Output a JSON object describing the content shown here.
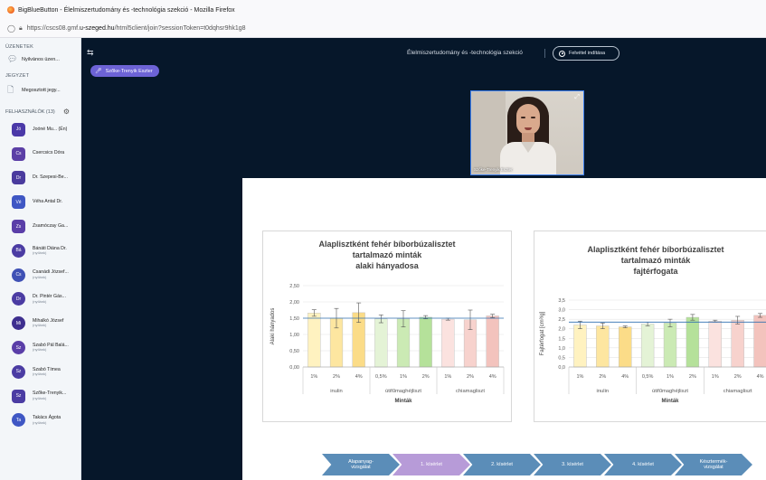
{
  "window": {
    "title": "BigBlueButton - Élelmiszertudomány és -technológia szekció - Mozilla Firefox",
    "url_prefix": "https://cscs08.gmf.",
    "url_domain": "u-szeged.hu",
    "url_suffix": "/html5client/join?sessionToken=t0dqhsr9hk1g8"
  },
  "sidebar": {
    "messages_title": "ÜZENETEK",
    "public_chat": "Nyilvános üzen...",
    "notes_title": "JEGYZET",
    "shared_notes": "Megosztott jegy...",
    "users_title": "FELHASZNÁLÓK (13)",
    "users": [
      {
        "initials": "Jó",
        "name": "Joóné Mu... (Én)",
        "sub": "",
        "color": "#4b39a8",
        "shape": "square",
        "badge": "green"
      },
      {
        "initials": "Cs",
        "name": "Csercsics Dóra",
        "sub": "",
        "color": "#5b3fa6",
        "shape": "square",
        "badge": ""
      },
      {
        "initials": "Dr",
        "name": "Dr. Szepesi-Be...",
        "sub": "",
        "color": "#4a3b9e",
        "shape": "square",
        "badge": "red"
      },
      {
        "initials": "Vé",
        "name": "Véha Antal Dr.",
        "sub": "",
        "color": "#3f57c4",
        "shape": "square",
        "badge": ""
      },
      {
        "initials": "Zs",
        "name": "Zsamóczay Ga...",
        "sub": "",
        "color": "#5a3ea8",
        "shape": "square",
        "badge": "red"
      },
      {
        "initials": "Bá",
        "name": "Bánáti Diána Dr.",
        "sub": "(nyílánk)",
        "color": "#4b3ca3",
        "shape": "round",
        "badge": "red"
      },
      {
        "initials": "Cs",
        "name": "Csanádi József...",
        "sub": "(nyílánk)",
        "color": "#3f51b5",
        "shape": "round",
        "badge": "green"
      },
      {
        "initials": "Dr",
        "name": "Dr. Pintér Gás...",
        "sub": "(nyílánk)",
        "color": "#4b3ca3",
        "shape": "round",
        "badge": "red"
      },
      {
        "initials": "Mi",
        "name": "Mihalkó József",
        "sub": "(nyílánk)",
        "color": "#3e2f8f",
        "shape": "round",
        "badge": "red"
      },
      {
        "initials": "Sz",
        "name": "Szabó Pál Balá...",
        "sub": "(nyílánk)",
        "color": "#5a3ea8",
        "shape": "round",
        "badge": "red"
      },
      {
        "initials": "Sz",
        "name": "Szabó Tímea",
        "sub": "(nyílánk)",
        "color": "#4b3ca3",
        "shape": "round",
        "badge": "green"
      },
      {
        "initials": "Sz",
        "name": "Szőke-Trenyik...",
        "sub": "(nyílánk)",
        "color": "#4b3ca3",
        "shape": "square",
        "badge": "green"
      },
      {
        "initials": "Ta",
        "name": "Takács Ágota",
        "sub": "(nyílánk)",
        "color": "#3f57c4",
        "shape": "round",
        "badge": "red"
      }
    ]
  },
  "main": {
    "session_title": "Élelmiszertudomány és -technológia szekció",
    "record_label": "Felvétel indítása",
    "presenter": "Szőke-Trenyik Eszter",
    "webcam_name": "Szőke-Trenyik Eszter"
  },
  "chart_data": [
    {
      "type": "bar",
      "title": "Alaplisztként fehér bíborbúzalisztet tartalmazó minták alaki hányadosa",
      "title_lines": [
        "Alaplisztként fehér bíborbúzalisztet",
        "tartalmazó minták",
        "alaki hányadosa"
      ],
      "ylabel": "Alaki hányados",
      "xlabel": "Minták",
      "ylim": [
        0,
        2.5
      ],
      "yticks": [
        "0,00",
        "0,50",
        "1,00",
        "1,50",
        "2,00",
        "2,50"
      ],
      "categories": [
        "1%",
        "2%",
        "4%",
        "0,5%",
        "1%",
        "2%",
        "1%",
        "2%",
        "4%"
      ],
      "groups": [
        {
          "label": "inulin",
          "count": 3
        },
        {
          "label": "útifűmaghéjliszt",
          "count": 3
        },
        {
          "label": "chiamagliszt",
          "count": 3
        }
      ],
      "values": [
        1.66,
        1.5,
        1.67,
        1.48,
        1.48,
        1.53,
        1.47,
        1.45,
        1.57
      ],
      "errors": [
        0.1,
        0.3,
        0.3,
        0.12,
        0.25,
        0.05,
        0.03,
        0.3,
        0.05
      ],
      "reference_line": 1.5,
      "colors": [
        "#fff2c0",
        "#fde6a0",
        "#fbdc88",
        "#e4f3d6",
        "#cbeab4",
        "#b5e19a",
        "#fbe2df",
        "#f7d2cd",
        "#f3c3bd"
      ]
    },
    {
      "type": "bar",
      "title": "Alaplisztként fehér bíborbúzalisztet tartalmazó minták fajtérfogata",
      "title_lines": [
        "Alaplisztként fehér bíborbúzalisztet",
        "tartalmazó minták",
        "fajtérfogata"
      ],
      "ylabel": "Fajtérfogat [cm³/g]",
      "xlabel": "Minták",
      "ylim": [
        0,
        3.5
      ],
      "yticks": [
        "0,0",
        "0,5",
        "1,0",
        "1,5",
        "2,0",
        "2,5",
        "3,0",
        "3,5"
      ],
      "categories": [
        "1%",
        "2%",
        "4%",
        "0,5%",
        "1%",
        "2%",
        "1%",
        "2%",
        "4%"
      ],
      "groups": [
        {
          "label": "inulin",
          "count": 3
        },
        {
          "label": "útifűmaghéjliszt",
          "count": 3
        },
        {
          "label": "chiamagliszt",
          "count": 3
        }
      ],
      "values": [
        2.2,
        2.15,
        2.1,
        2.25,
        2.3,
        2.6,
        2.4,
        2.45,
        2.7
      ],
      "errors": [
        0.2,
        0.15,
        0.05,
        0.1,
        0.2,
        0.15,
        0.05,
        0.2,
        0.1
      ],
      "reference_line": 2.35,
      "colors": [
        "#fff2c0",
        "#fde6a0",
        "#fbdc88",
        "#e4f3d6",
        "#cbeab4",
        "#b5e19a",
        "#fbe2df",
        "#f7d2cd",
        "#f3c3bd"
      ]
    }
  ],
  "flow": {
    "steps": [
      {
        "label": "Alapanyag-vizsgálat",
        "line1": "Alapanyag-",
        "line2": "vizsgálat",
        "color": "#5b8db8"
      },
      {
        "label": "1. kísérlet",
        "line1": "1. kísérlet",
        "line2": "",
        "color": "#b79bd8"
      },
      {
        "label": "2. kísérlet",
        "line1": "2. kísérlet",
        "line2": "",
        "color": "#5b8db8"
      },
      {
        "label": "3. kísérlet",
        "line1": "3. kísérlet",
        "line2": "",
        "color": "#5b8db8"
      },
      {
        "label": "4. kísérlet",
        "line1": "4. kísérlet",
        "line2": "",
        "color": "#5b8db8"
      },
      {
        "label": "Késztermék-vizsgálat",
        "line1": "Késztermék-",
        "line2": "vizsgálat",
        "color": "#5b8db8"
      }
    ]
  }
}
